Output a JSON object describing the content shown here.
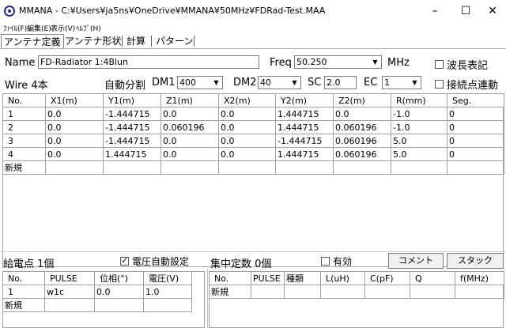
{
  "window": {
    "title": "MMANA - C:¥Users¥ja5ns¥OneDrive¥MMANA¥50MHz¥FDRad-Test.MAA",
    "minimize": "–",
    "maximize": "☐",
    "close": "✕"
  },
  "menu": [
    "ﾌｧｲﾙ(F)",
    "編集(E)",
    "表示(V)",
    "ﾍﾙﾌﾟ(H)"
  ],
  "tabs": [
    "アンテナ定義",
    "アンテナ形状",
    "計算",
    "パターン"
  ],
  "antenna": {
    "name_label": "Name",
    "name_value": "FD-Radiator 1:4Blun",
    "freq_label": "Freq",
    "freq_value": "50.250",
    "freq_unit": "MHz",
    "wavelength_label": "波長表記",
    "wire_count": "Wire 4本",
    "auto_split": "自動分割",
    "dm1_label": "DM1",
    "dm1_value": "400",
    "dm2_label": "DM2",
    "dm2_value": "40",
    "sc_label": "SC",
    "sc_value": "2.0",
    "ec_label": "EC",
    "ec_value": "1",
    "connect_label": "接続点連動"
  },
  "wires": {
    "columns": [
      "No.",
      "X1(m)",
      "Y1(m)",
      "Z1(m)",
      "X2(m)",
      "Y2(m)",
      "Z2(m)",
      "R(mm)",
      "Seg."
    ],
    "rows": [
      [
        "1",
        "0.0",
        "-1.444715",
        "0.0",
        "0.0",
        "1.444715",
        "0.0",
        "-1.0",
        "0"
      ],
      [
        "2",
        "0.0",
        "-1.444715",
        "0.060196",
        "0.0",
        "1.444715",
        "0.060196",
        "-1.0",
        "0"
      ],
      [
        "3",
        "0.0",
        "-1.444715",
        "0.0",
        "0.0",
        "-1.444715",
        "0.060196",
        "5.0",
        "0"
      ],
      [
        "4",
        "0.0",
        "1.444715",
        "0.0",
        "0.0",
        "1.444715",
        "0.060196",
        "5.0",
        "0"
      ]
    ],
    "new_row": "新規"
  },
  "feed": {
    "label": "給電点 1個",
    "auto_voltage": "電圧自動設定",
    "columns": [
      "No.",
      "PULSE",
      "位相(°)",
      "電圧(V)"
    ],
    "rows": [
      [
        "1",
        "w1c",
        "0.0",
        "1.0"
      ]
    ],
    "new_row": "新規"
  },
  "loads": {
    "label": "集中定数 0個",
    "enabled_label": "有効",
    "comment_button": "コメント",
    "stack_button": "スタック",
    "columns": [
      "No.",
      "PULSE",
      "種類",
      "L(uH)",
      "C(pF)",
      "Q",
      "f(MHz)"
    ],
    "new_row": "新規"
  }
}
